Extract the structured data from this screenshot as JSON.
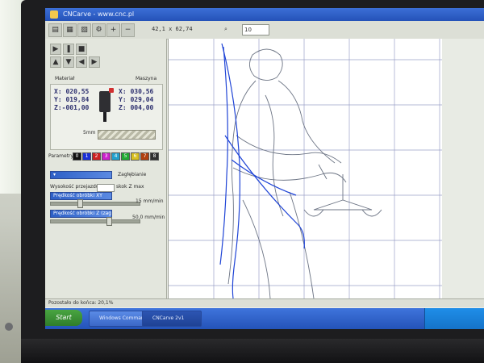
{
  "window": {
    "title": "CNCarve - www.cnc.pl"
  },
  "toolbar": {
    "coords": "42,1 x 62,74",
    "zoom_value": "10"
  },
  "panel": {
    "material_label": "Materiał",
    "machine_label": "Maszyna",
    "material_x": "X: 020,55",
    "material_y": "Y: 019,84",
    "material_z": "Z:-001,00",
    "machine_x": "X: 030,56",
    "machine_y": "Y: 029,04",
    "machine_z": "Z: 004,00",
    "tool_size": "5mm",
    "params_label": "Parametry",
    "colors": [
      {
        "n": "0",
        "c": "#111111"
      },
      {
        "n": "1",
        "c": "#1b2fd6"
      },
      {
        "n": "2",
        "c": "#cc2020"
      },
      {
        "n": "3",
        "c": "#cc22cc"
      },
      {
        "n": "4",
        "c": "#22a0cc"
      },
      {
        "n": "5",
        "c": "#22aa33"
      },
      {
        "n": "6",
        "c": "#d8c020"
      },
      {
        "n": "7",
        "c": "#b04010"
      },
      {
        "n": "8",
        "c": "#303030"
      }
    ],
    "engrave_label": "Zagłębianie",
    "lift_label": "Wysokość przejazdu",
    "depth_label": "skok Z max",
    "feed_label": "Prędkość obróbki XY",
    "feed_value": "15 mm/min",
    "plunge_label": "Prędkość obróbki Z (zagłębianie)",
    "plunge_value": "50,0 mm/min"
  },
  "status": {
    "text": "Pozostało do końca: 20,1%"
  },
  "taskbar": {
    "start": "Start",
    "tasks": [
      "Windows Commander",
      "CNCarve 2v1"
    ]
  }
}
